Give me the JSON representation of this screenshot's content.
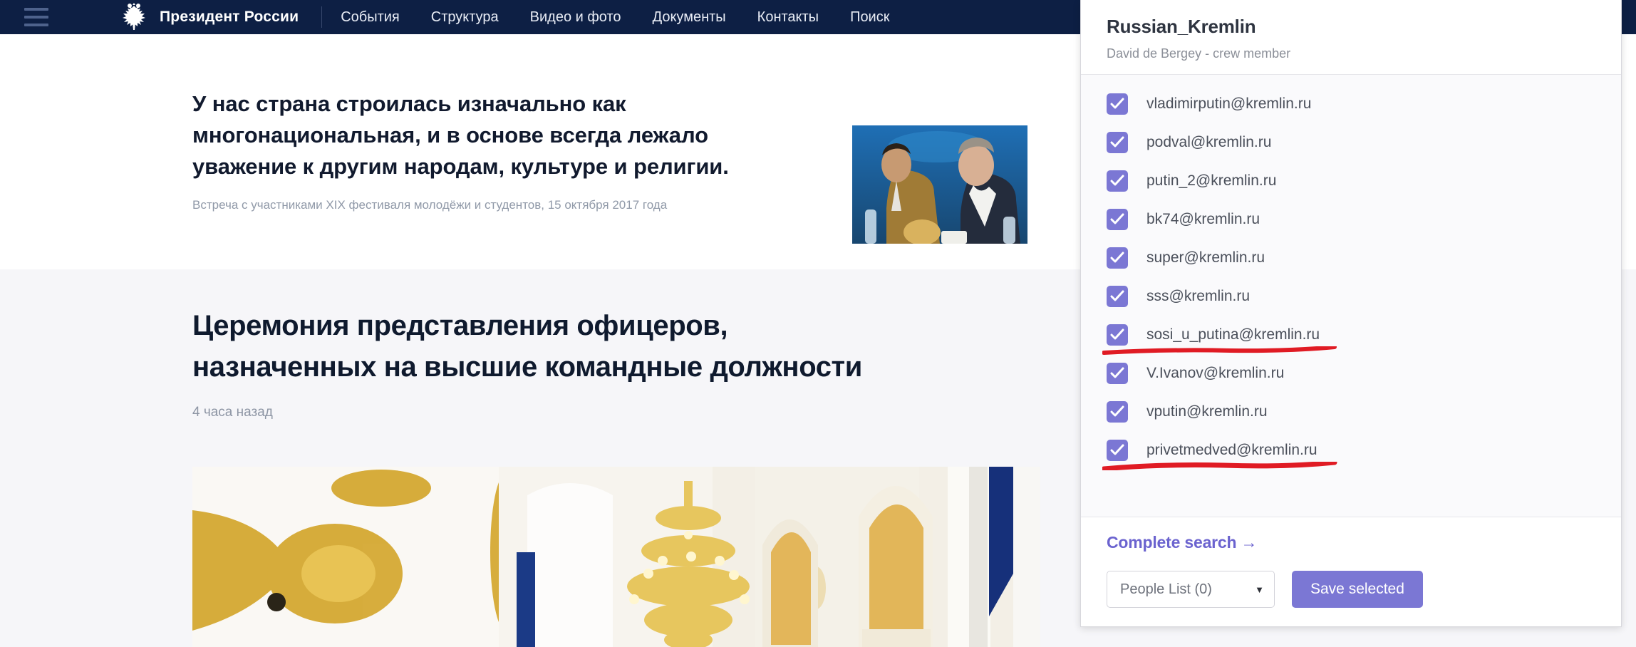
{
  "site": {
    "nav": {
      "menu_icon": "hamburger-icon",
      "logo_icon": "russian-eagle-emblem-icon",
      "brand": "Президент России",
      "links": [
        {
          "label": "События"
        },
        {
          "label": "Структура"
        },
        {
          "label": "Видео и фото"
        },
        {
          "label": "Документы"
        },
        {
          "label": "Контакты"
        },
        {
          "label": "Поиск"
        }
      ]
    },
    "quote": {
      "line1": "У нас страна строилась изначально как",
      "line2": "многонациональная, и в основе всегда лежало",
      "line3": "уважение к другим народам, культуре и религии.",
      "caption": "Встреча с участниками XIX фестиваля молодёжи и студентов, 15 октября 2017 года",
      "photo_alt": "Фотография встречи"
    },
    "article": {
      "title_line1": "Церемония представления офицеров,",
      "title_line2": "назначенных на высшие командные должности",
      "time": "4 часа назад",
      "photo_alt": "Георгиевский зал Кремля"
    }
  },
  "panel": {
    "title": "Russian_Kremlin",
    "subtitle": "David de Bergey - crew member",
    "accent_color": "#7b77d4",
    "annotation_color": "#e01b24",
    "emails": [
      {
        "address": "vladimirputin@kremlin.ru",
        "checked": true,
        "annotated": false
      },
      {
        "address": "podval@kremlin.ru",
        "checked": true,
        "annotated": false
      },
      {
        "address": "putin_2@kremlin.ru",
        "checked": true,
        "annotated": false
      },
      {
        "address": "bk74@kremlin.ru",
        "checked": true,
        "annotated": false
      },
      {
        "address": "super@kremlin.ru",
        "checked": true,
        "annotated": false
      },
      {
        "address": "sss@kremlin.ru",
        "checked": true,
        "annotated": false
      },
      {
        "address": "sosi_u_putina@kremlin.ru",
        "checked": true,
        "annotated": true
      },
      {
        "address": "V.Ivanov@kremlin.ru",
        "checked": true,
        "annotated": false
      },
      {
        "address": "vputin@kremlin.ru",
        "checked": true,
        "annotated": false
      },
      {
        "address": "privetmedved@kremlin.ru",
        "checked": true,
        "annotated": true
      }
    ],
    "complete_search_label": "Complete search →",
    "people_list_value": "People List (0)",
    "caret_glyph": "▼",
    "save_label": "Save selected"
  }
}
